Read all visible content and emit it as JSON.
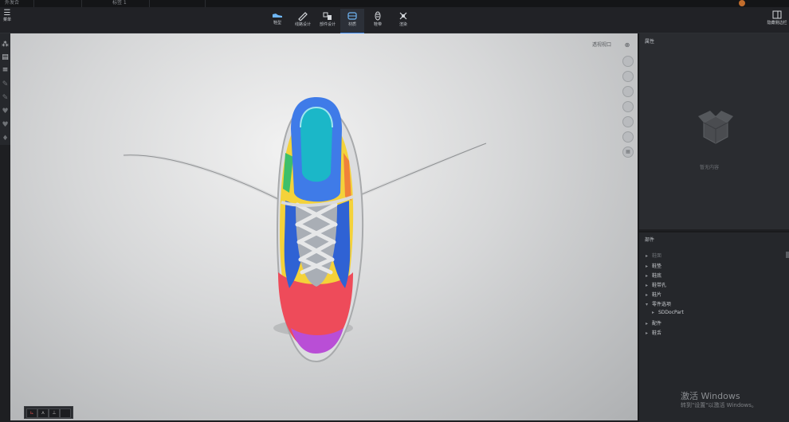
{
  "window_tabs": [
    "外发合",
    "",
    "标签 1",
    ""
  ],
  "menu": {
    "label": "菜单"
  },
  "toolbar": {
    "items": [
      {
        "label": "鞋型",
        "icon": "shoe-icon"
      },
      {
        "label": "线路设计",
        "icon": "pen-icon"
      },
      {
        "label": "部件设计",
        "icon": "parts-icon"
      },
      {
        "label": "材质",
        "icon": "material-icon"
      },
      {
        "label": "鞋带",
        "icon": "lace-icon"
      },
      {
        "label": "渲染",
        "icon": "render-icon"
      }
    ],
    "active_index": 3,
    "right_label": "隐藏侧边栏"
  },
  "viewport": {
    "view_label": "透视视口",
    "side_buttons": [
      "reset-view-icon",
      "front-view-icon",
      "top-view-icon",
      "side-view-icon",
      "lighting-icon",
      "camera-icon",
      "grid-icon"
    ]
  },
  "attributes_panel": {
    "title": "属性",
    "empty_text": "暂无内容"
  },
  "parts_panel": {
    "title": "部件",
    "items": [
      {
        "label": "鞋面",
        "expanded": false,
        "indent": 0
      },
      {
        "label": "鞋垫",
        "expanded": false,
        "indent": 0
      },
      {
        "label": "鞋底",
        "expanded": false,
        "indent": 0
      },
      {
        "label": "鞋带孔",
        "expanded": false,
        "indent": 0
      },
      {
        "label": "鞋片",
        "expanded": false,
        "indent": 0
      },
      {
        "label": "零件选项",
        "expanded": true,
        "indent": 0
      },
      {
        "label": "SDDocPart",
        "expanded": false,
        "indent": 1
      },
      {
        "label": "配件",
        "expanded": false,
        "indent": 0
      },
      {
        "label": "鞋舌",
        "expanded": false,
        "indent": 0
      }
    ]
  },
  "watermark": {
    "title": "激活 Windows",
    "subtitle": "转到\"设置\"以激活 Windows。"
  },
  "colors": {
    "accent": "#3f8cf0",
    "panel": "#2a2c30",
    "toolbar": "#212226"
  }
}
